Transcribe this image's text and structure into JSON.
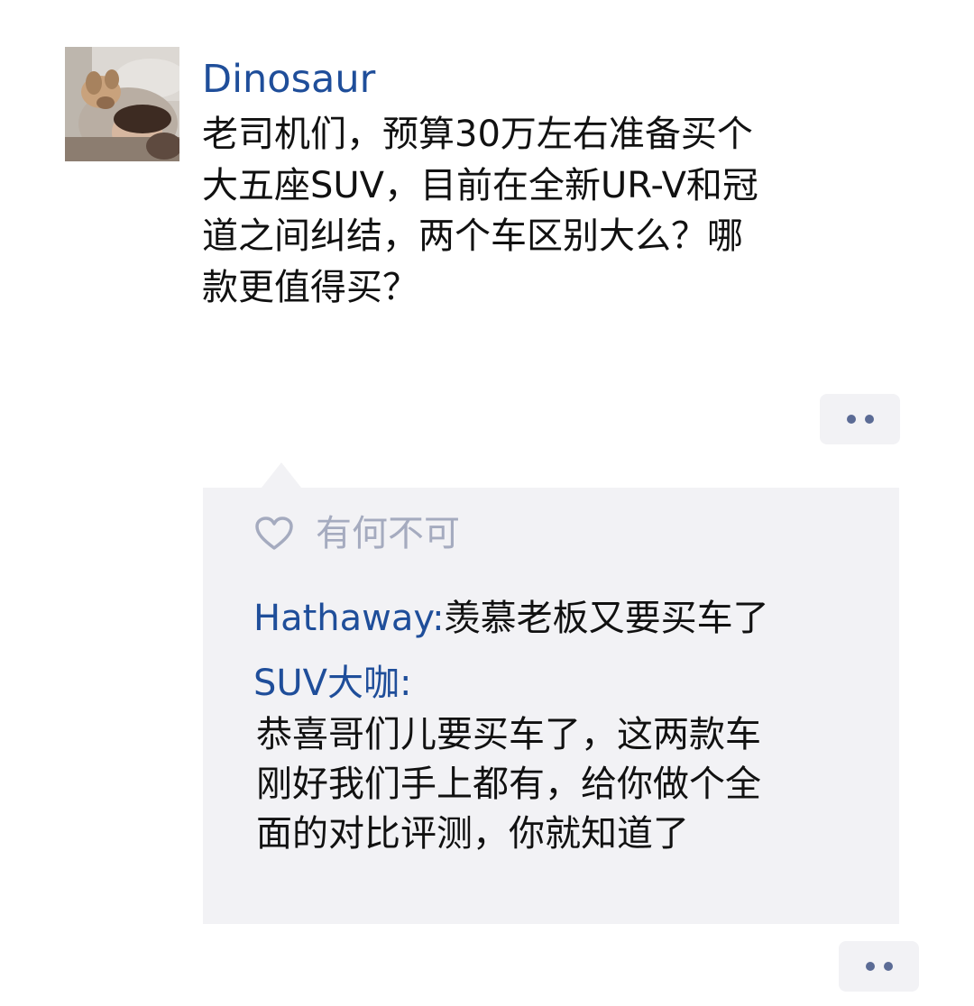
{
  "post": {
    "author": "Dinosaur",
    "avatar_icon": "user-avatar-photo",
    "text_lines": [
      "老司机们，预算30万左右准备买个",
      "大五座SUV，目前在全新UR-V和冠",
      "道之间纠结，两个车区别大么？哪",
      "款更值得买？"
    ],
    "more_icon": "more-dots-icon"
  },
  "likes": {
    "icon": "heart-outline-icon",
    "names": "有何不可"
  },
  "comments": [
    {
      "author": "Hathaway",
      "separator": ":",
      "text": "羡慕老板又要买车了"
    },
    {
      "author": "SUV大咖",
      "separator": ":",
      "text_lines": [
        "恭喜哥们儿要买车了，这两款车",
        "刚好我们手上都有，给你做个全",
        "面的对比评测，你就知道了"
      ]
    }
  ],
  "colors": {
    "name_link": "#1f4e9a",
    "text": "#111111",
    "likes_text": "#a5abbf",
    "panel_bg": "#f2f2f5",
    "dots": "#5b6b95"
  }
}
